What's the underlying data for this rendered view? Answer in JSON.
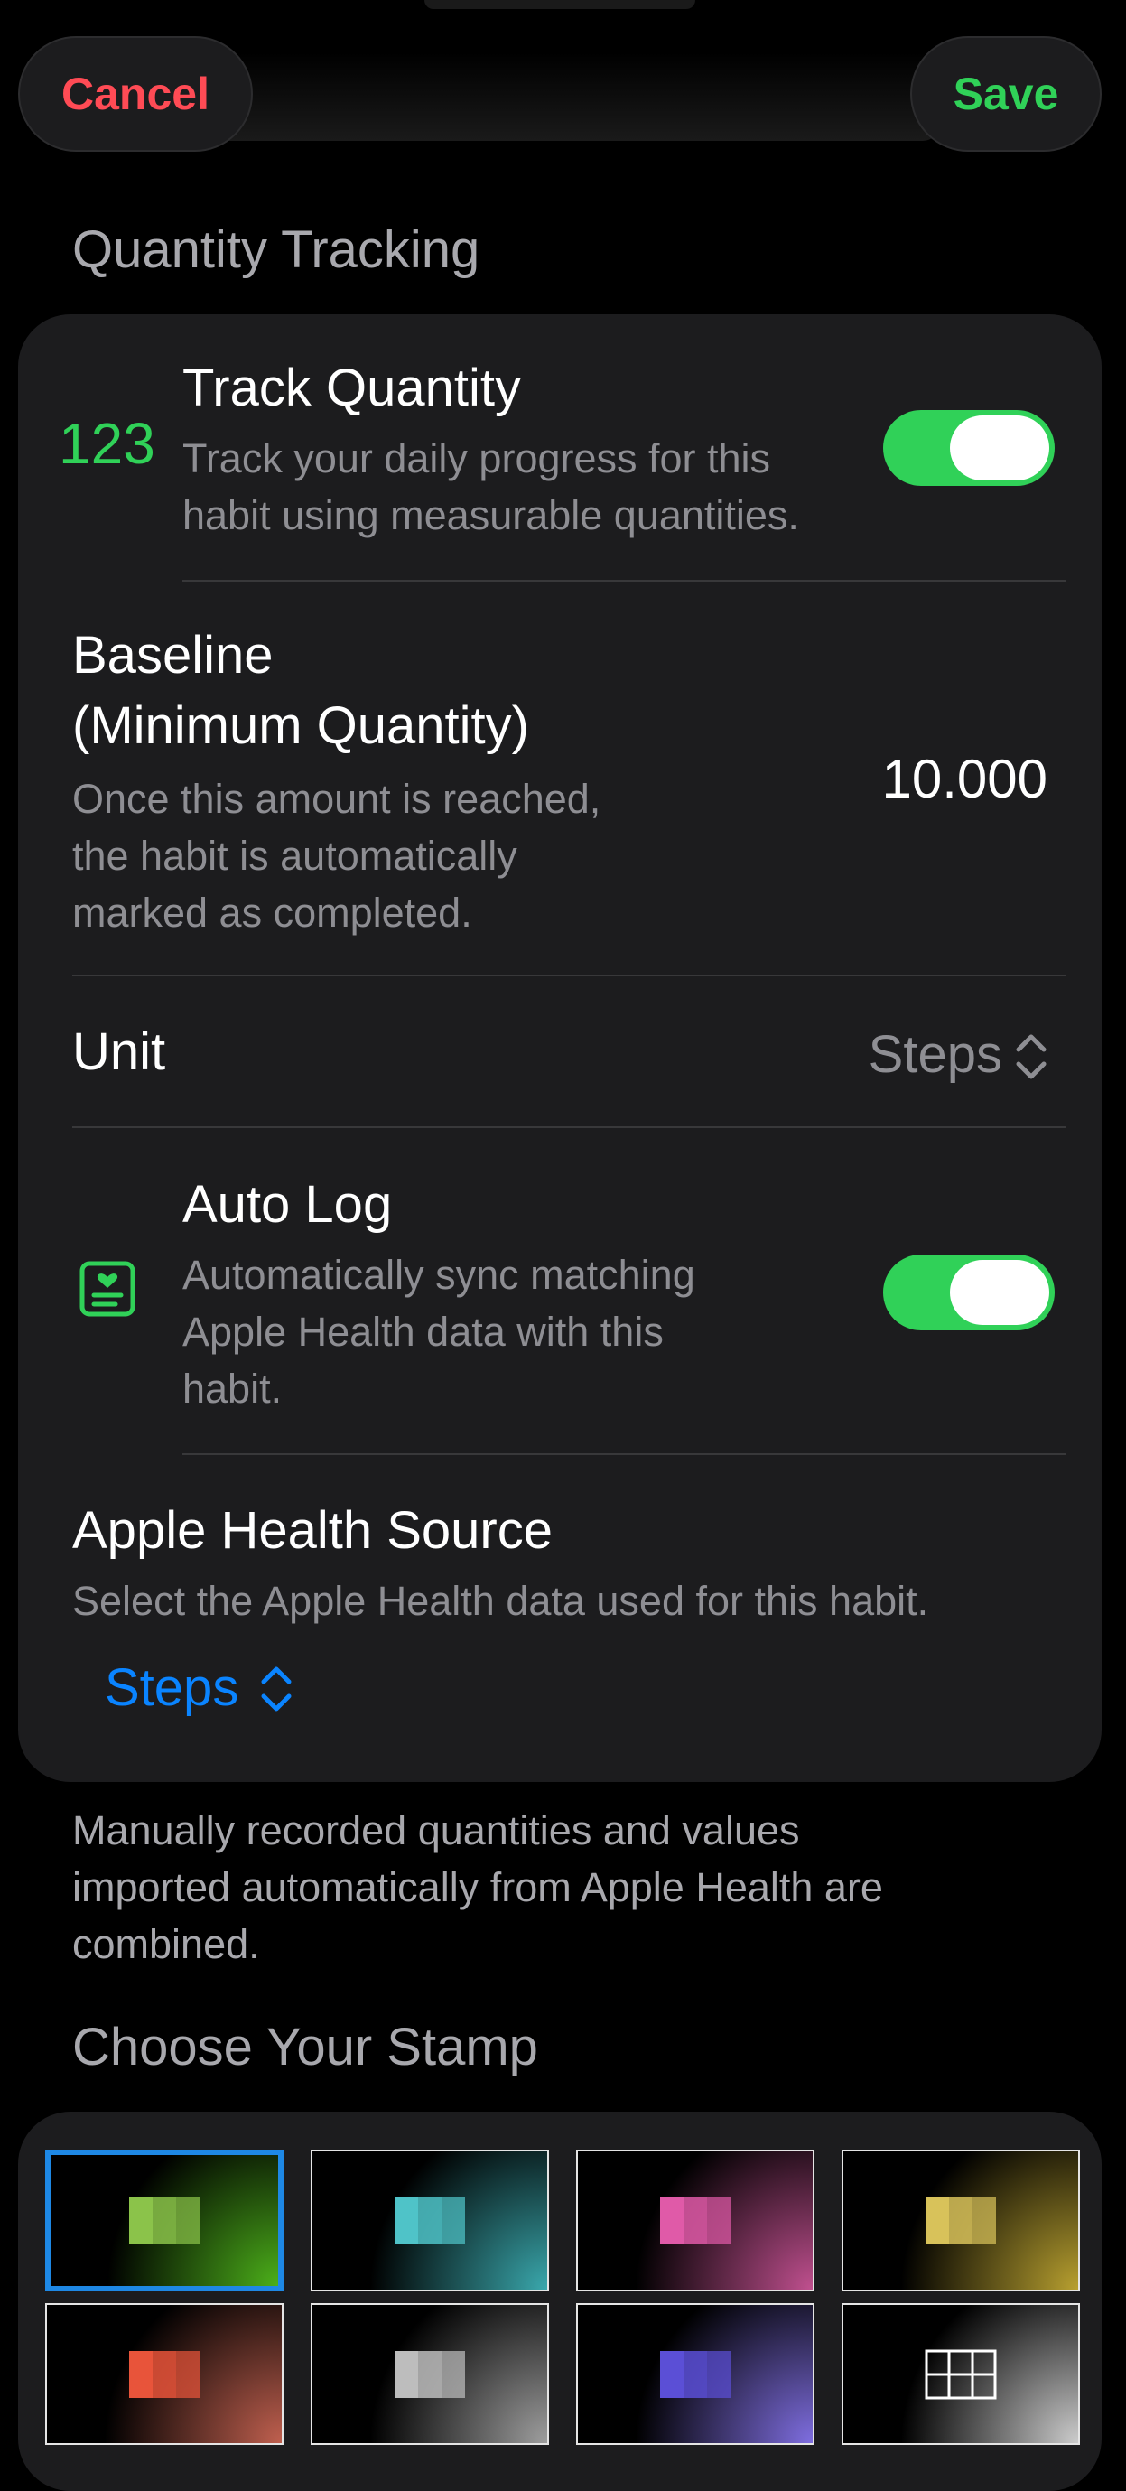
{
  "nav": {
    "cancel_label": "Cancel",
    "save_label": "Save"
  },
  "quantity_section": {
    "header": "Quantity Tracking",
    "track_quantity": {
      "icon_text": "123",
      "title": "Track Quantity",
      "description_line1": "Track your daily progress for this",
      "description_line2": "habit using measurable quantities.",
      "enabled": true
    },
    "baseline": {
      "title_line1": "Baseline",
      "title_line2": "(Minimum Quantity)",
      "description_line1": "Once this amount is reached,",
      "description_line2": "the habit is automatically",
      "description_line3": "marked as completed.",
      "value": "10.000"
    },
    "unit": {
      "label": "Unit",
      "value": "Steps"
    },
    "auto_log": {
      "icon": "health-record-icon",
      "title": "Auto Log",
      "description_line1": "Automatically sync matching",
      "description_line2": "Apple Health data with this",
      "description_line3": "habit.",
      "enabled": true
    },
    "health_source": {
      "title": "Apple Health Source",
      "description": "Select the Apple Health data used for this habit.",
      "value": "Steps"
    }
  },
  "footer_note": {
    "line1": "Manually recorded quantities and values",
    "line2": "imported automatically from Apple Health are",
    "line3": "combined."
  },
  "stamp_section": {
    "header": "Choose Your Stamp",
    "selected_index": 0,
    "stamps": [
      {
        "name": "green",
        "color": "#8bc34a",
        "glow": "#4caf1a"
      },
      {
        "name": "teal",
        "color": "#4fc3c8",
        "glow": "#3aa8ad"
      },
      {
        "name": "pink",
        "color": "#e05aa8",
        "glow": "#c0508f"
      },
      {
        "name": "gold",
        "color": "#d8c25a",
        "glow": "#b8a030"
      },
      {
        "name": "red",
        "color": "#e8543a",
        "glow": "#c0604f"
      },
      {
        "name": "gray",
        "color": "#bdbdbd",
        "glow": "#9e9e9e"
      },
      {
        "name": "blue-purple",
        "color": "#5b4fd6",
        "glow": "#7f6ee0"
      },
      {
        "name": "grid",
        "color": "#ffffff",
        "glow": "#cccccc"
      }
    ]
  },
  "colors": {
    "accent_green": "#30d158",
    "destructive_red": "#ff4b55",
    "link_blue": "#0a84ff",
    "card_background": "#1c1c1e",
    "secondary_text": "#8e8e93"
  }
}
